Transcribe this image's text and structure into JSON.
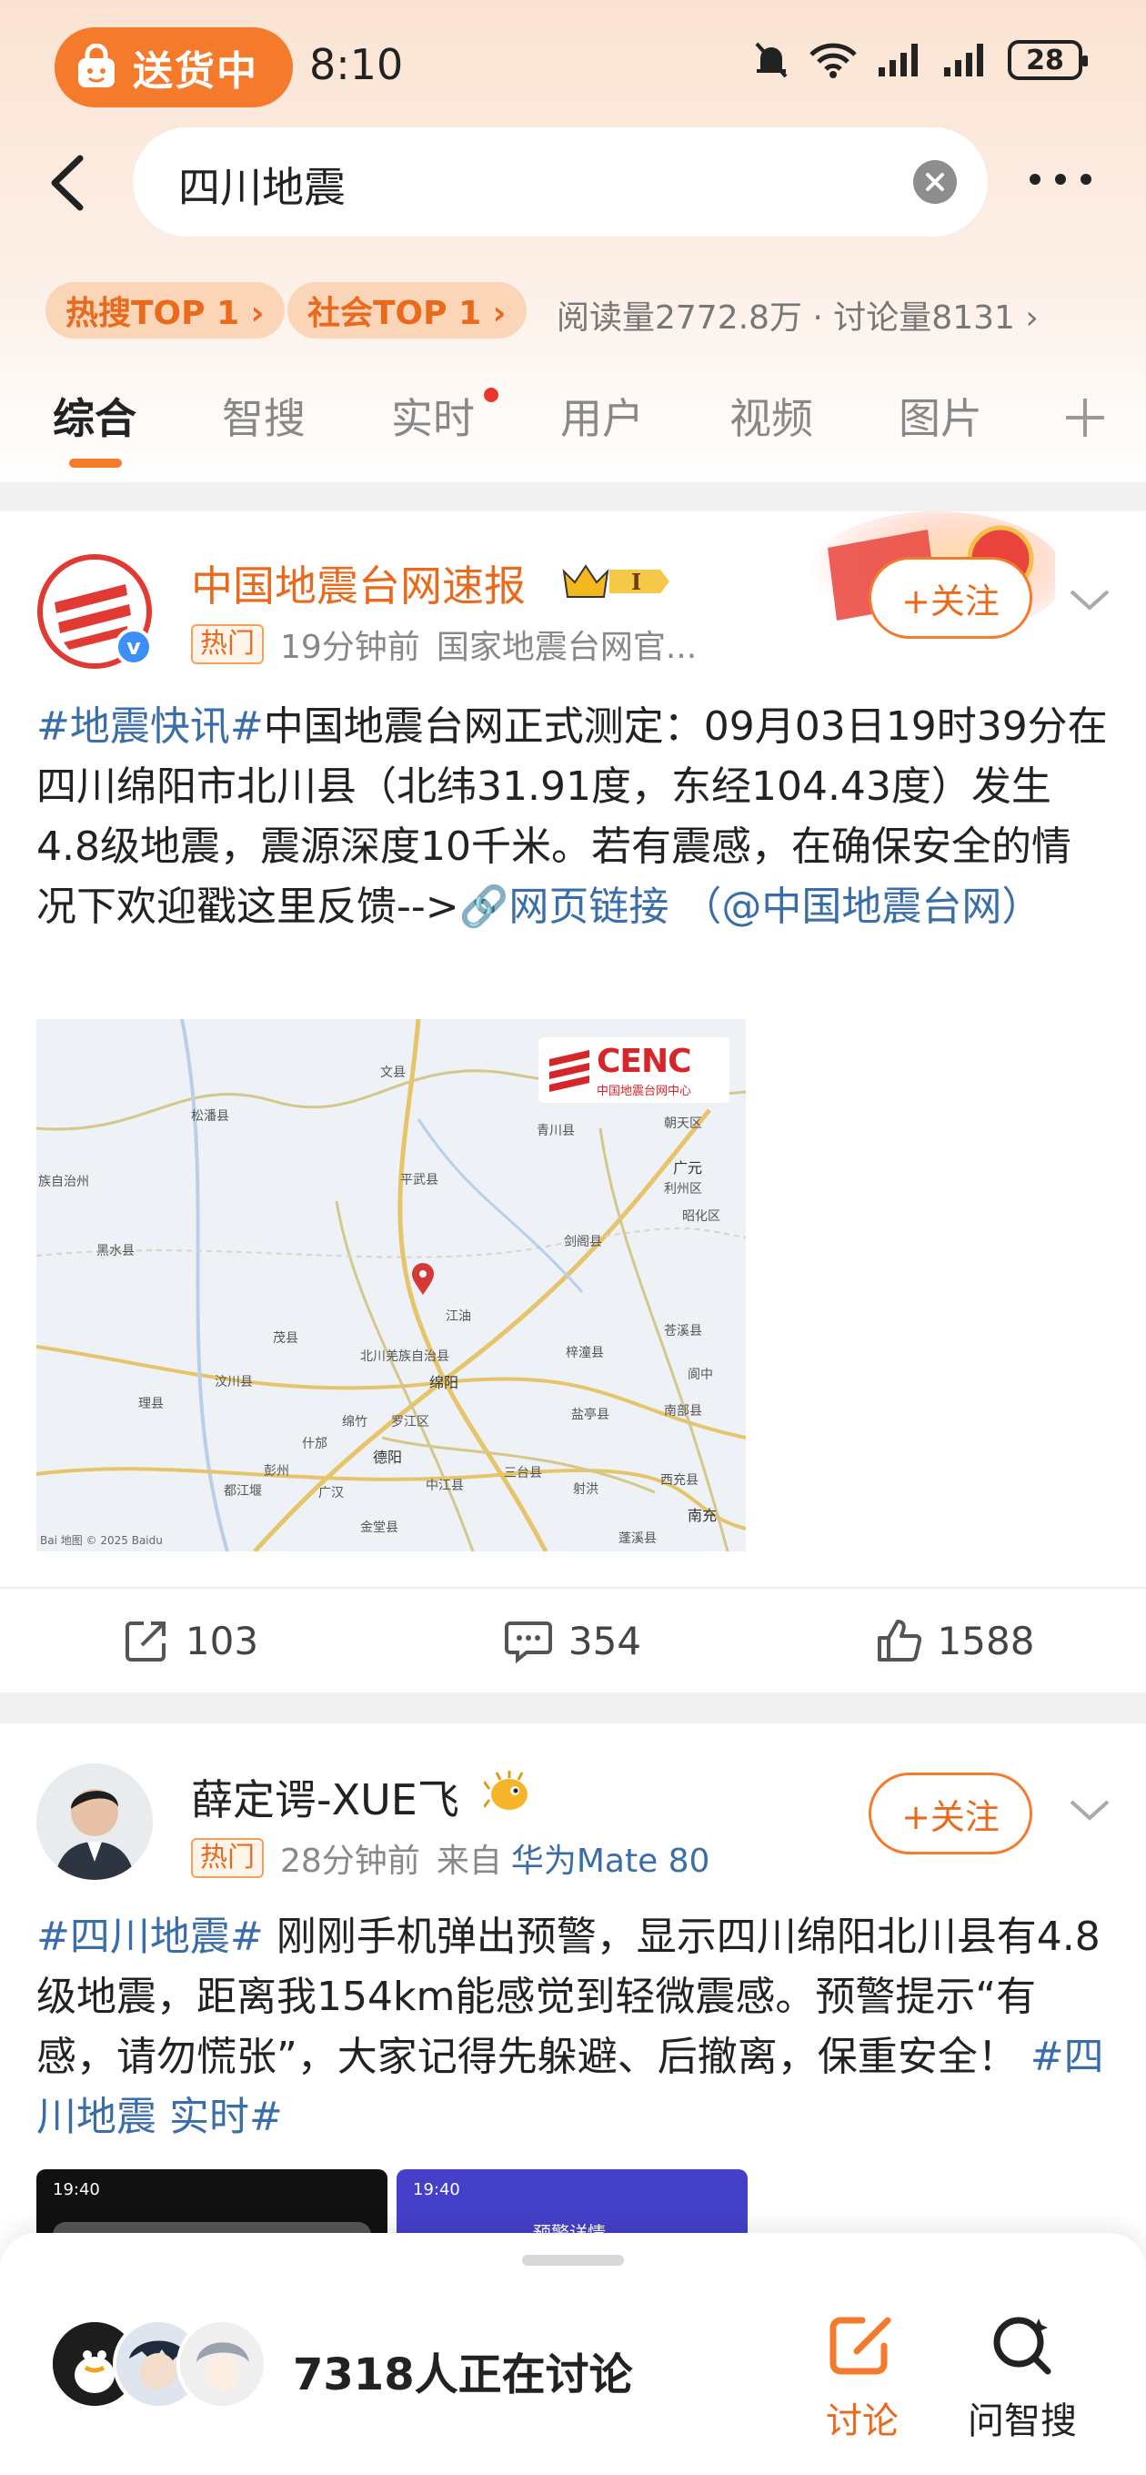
{
  "status_bar": {
    "pill_label": "送货中",
    "time": "8:10",
    "battery": "28"
  },
  "search": {
    "query": "四川地震"
  },
  "hot": {
    "chip1": "热搜TOP 1 ›",
    "chip2": "社会TOP 1 ›",
    "reads": "阅读量2772.8万 · 讨论量8131 ›"
  },
  "tabs": [
    "综合",
    "智搜",
    "实时",
    "用户",
    "视频",
    "图片"
  ],
  "post1": {
    "username": "中国地震台网速报",
    "badge": "热门",
    "time": "19分钟前",
    "source": "国家地震台网官...",
    "follow": "+关注",
    "tag": "#地震快讯#",
    "text_body": "中国地震台网正式测定：09月03日19时39分在四川绵阳市北川县（北纬31.91度，东经104.43度）发生4.8级地震，震源深度10千米。若有震感，在确保安全的情况下欢迎戳这里反馈-->",
    "link": "🔗网页链接",
    "mention": "（@中国地震台网）",
    "map": {
      "logo": "CENC",
      "logo_sub": "中国地震台网中心",
      "credit": "Bai 地图 © 2025 Baidu",
      "labels": [
        "文县",
        "松潘县",
        "青川县",
        "朝天区",
        "广元",
        "平武县",
        "利州区",
        "剑阁县",
        "昭化区",
        "黑水县",
        "江油",
        "梓潼县",
        "苍溪县",
        "茂县",
        "北川羌族自治县",
        "绵阳",
        "阆中",
        "汶川县",
        "盐亭县",
        "南部县",
        "理县",
        "绵竹",
        "罗江区",
        "什邡",
        "德阳",
        "三台县",
        "西充县",
        "中江县",
        "射洪",
        "南充",
        "都江堰",
        "彭州",
        "广汉",
        "金堂县",
        "蓬溪县",
        "族自治州"
      ]
    },
    "shares": "103",
    "comments": "354",
    "likes": "1588"
  },
  "post2": {
    "username": "薛定谔-XUE飞",
    "badge": "热门",
    "time": "28分钟前",
    "source_prefix": "来自",
    "source": "华为Mate 80",
    "follow": "+关注",
    "tag1": "#四川地震#",
    "text_body": " 刚刚手机弹出预警，显示四川绵阳北川县有4.8级地震，距离我154km能感觉到轻微震感。预警提示“有感，请勿慌张”，大家记得先躲避、后撤离，保重安全！ ",
    "tag2": "#四川地震 实时#",
    "thumb1_time": "19:40",
    "thumb2_time": "19:40",
    "thumb2_title": "预警详情"
  },
  "bottom": {
    "discuss": "7318人正在讨论",
    "btn_discuss": "讨论",
    "btn_ask": "问智搜"
  },
  "colors": {
    "accent": "#f57a2c",
    "link": "#3a6ea8",
    "red": "#e8382d"
  }
}
